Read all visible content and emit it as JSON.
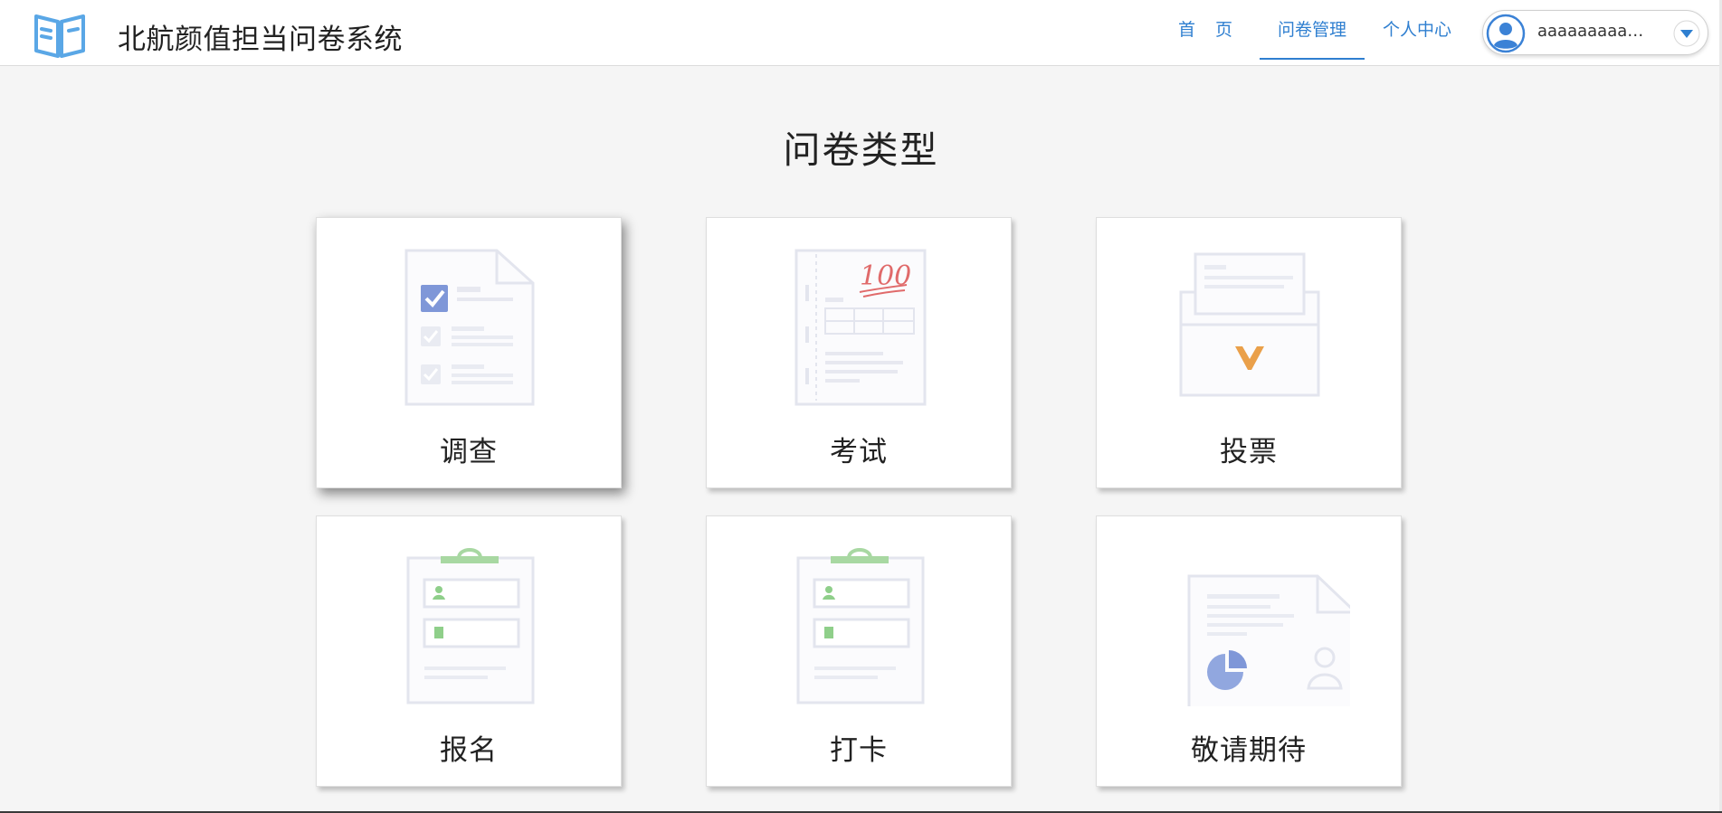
{
  "header": {
    "app_title": "北航颜值担当问卷系统",
    "logo_icon": "book-icon",
    "nav": {
      "home": "首 页",
      "manage": "问卷管理",
      "personal": "个人中心"
    },
    "active_nav": "manage",
    "user": {
      "name": "aaaaaaaaaa...",
      "avatar_icon": "user-avatar-icon",
      "dropdown_icon": "chevron-down-icon"
    },
    "accent_color": "#2f7fd0"
  },
  "main": {
    "heading": "问卷类型",
    "cards": [
      {
        "label": "调查",
        "icon": "survey-checklist-icon"
      },
      {
        "label": "考试",
        "icon": "exam-paper-icon"
      },
      {
        "label": "投票",
        "icon": "ballot-box-icon"
      },
      {
        "label": "报名",
        "icon": "signup-clipboard-icon"
      },
      {
        "label": "打卡",
        "icon": "checkin-clipboard-icon"
      },
      {
        "label": "敬请期待",
        "icon": "coming-soon-document-icon"
      }
    ],
    "hovered_card": 0
  }
}
